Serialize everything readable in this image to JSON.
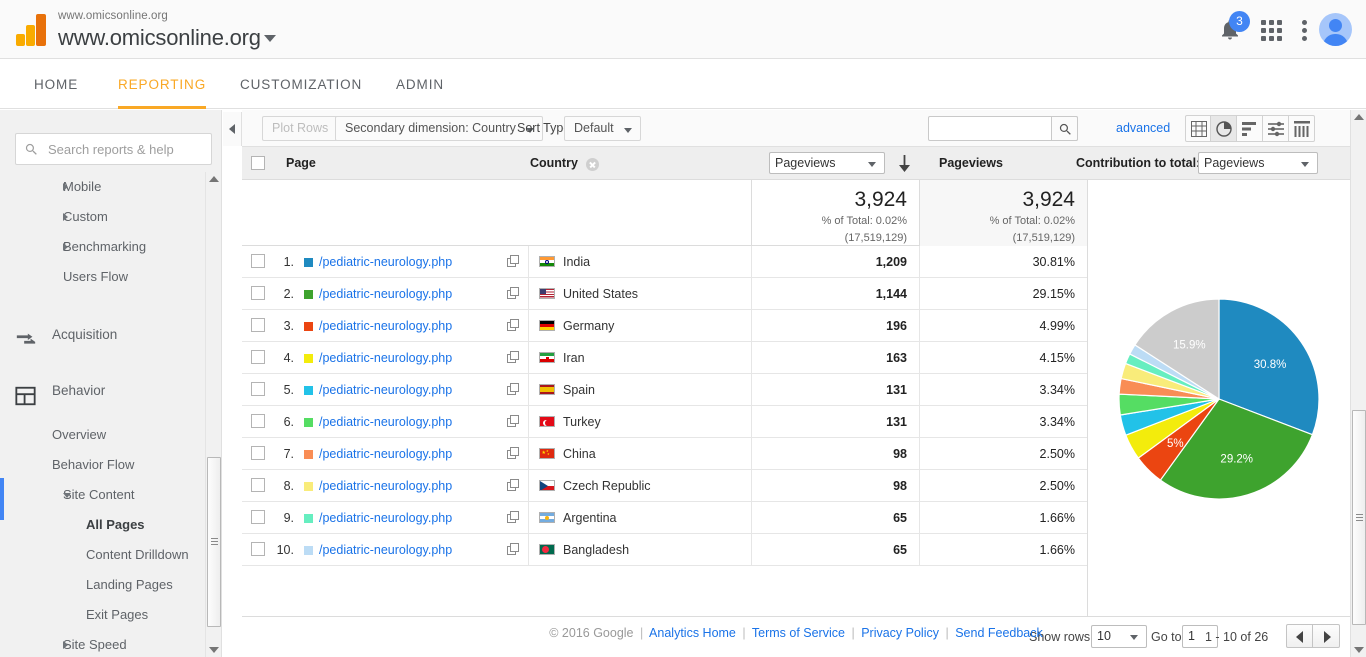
{
  "header": {
    "property_sub": "www.omicsonline.org",
    "property_title": "www.omicsonline.org",
    "notifications_count": "3"
  },
  "nav_tabs": [
    {
      "label": "HOME",
      "active": false
    },
    {
      "label": "REPORTING",
      "active": true
    },
    {
      "label": "CUSTOMIZATION",
      "active": false
    },
    {
      "label": "ADMIN",
      "active": false
    }
  ],
  "sidebar": {
    "search_placeholder": "Search reports & help",
    "items": [
      {
        "label": "Mobile",
        "level": 2,
        "arrow": "right"
      },
      {
        "label": "Custom",
        "level": 2,
        "arrow": "right"
      },
      {
        "label": "Benchmarking",
        "level": 2,
        "arrow": "right"
      },
      {
        "label": "Users Flow",
        "level": 2,
        "arrow": "none"
      },
      {
        "label": "Acquisition",
        "level": 0,
        "arrow": "none",
        "icon": "acquisition-icon"
      },
      {
        "label": "Behavior",
        "level": 0,
        "arrow": "none",
        "icon": "behavior-icon",
        "selected_section": true
      },
      {
        "label": "Overview",
        "level": 1,
        "arrow": "none"
      },
      {
        "label": "Behavior Flow",
        "level": 1,
        "arrow": "none"
      },
      {
        "label": "Site Content",
        "level": 2,
        "arrow": "down"
      },
      {
        "label": "All Pages",
        "level": 3,
        "arrow": "none",
        "selected": true
      },
      {
        "label": "Content Drilldown",
        "level": 3,
        "arrow": "none"
      },
      {
        "label": "Landing Pages",
        "level": 3,
        "arrow": "none"
      },
      {
        "label": "Exit Pages",
        "level": 3,
        "arrow": "none"
      },
      {
        "label": "Site Speed",
        "level": 2,
        "arrow": "right"
      }
    ]
  },
  "toolbar": {
    "plot_rows_label": "Plot Rows",
    "secondary_dimension_label": "Secondary dimension: Country",
    "sort_type_label": "Sort Type:",
    "sort_type_value": "Default",
    "search_value": "",
    "advanced_label": "advanced",
    "view_icons": [
      {
        "name": "table-view-icon",
        "active": false
      },
      {
        "name": "pie-chart-view-icon",
        "active": true
      },
      {
        "name": "bar-chart-view-icon",
        "active": false
      },
      {
        "name": "comparison-view-icon",
        "active": false
      },
      {
        "name": "pivot-view-icon",
        "active": false
      }
    ]
  },
  "table": {
    "headers": {
      "page": "Page",
      "country": "Country",
      "metric_select": "Pageviews",
      "pageviews": "Pageviews",
      "contribution_label": "Contribution to total:",
      "contribution_select": "Pageviews"
    },
    "totals": {
      "pageviews_value": "3,924",
      "pageviews_pct": "% of Total: 0.02%",
      "pageviews_abs": "(17,519,129)",
      "contrib_value": "3,924",
      "contrib_pct": "% of Total: 0.02%",
      "contrib_abs": "(17,519,129)"
    },
    "rows": [
      {
        "index": "1.",
        "page": "/pediatric-neurology.php",
        "country": "India",
        "pageviews": "1,209",
        "contribution": "30.81%",
        "color": "#1f8ac0",
        "flag": "in"
      },
      {
        "index": "2.",
        "page": "/pediatric-neurology.php",
        "country": "United States",
        "pageviews": "1,144",
        "contribution": "29.15%",
        "color": "#3ea32e",
        "flag": "us"
      },
      {
        "index": "3.",
        "page": "/pediatric-neurology.php",
        "country": "Germany",
        "pageviews": "196",
        "contribution": "4.99%",
        "color": "#eb4511",
        "flag": "de"
      },
      {
        "index": "4.",
        "page": "/pediatric-neurology.php",
        "country": "Iran",
        "pageviews": "163",
        "contribution": "4.15%",
        "color": "#f3ec0c",
        "flag": "ir"
      },
      {
        "index": "5.",
        "page": "/pediatric-neurology.php",
        "country": "Spain",
        "pageviews": "131",
        "contribution": "3.34%",
        "color": "#22c2e8",
        "flag": "es"
      },
      {
        "index": "6.",
        "page": "/pediatric-neurology.php",
        "country": "Turkey",
        "pageviews": "131",
        "contribution": "3.34%",
        "color": "#55dd63",
        "flag": "tr"
      },
      {
        "index": "7.",
        "page": "/pediatric-neurology.php",
        "country": "China",
        "pageviews": "98",
        "contribution": "2.50%",
        "color": "#f98d55",
        "flag": "cn"
      },
      {
        "index": "8.",
        "page": "/pediatric-neurology.php",
        "country": "Czech Republic",
        "pageviews": "98",
        "contribution": "2.50%",
        "color": "#f9ec7a",
        "flag": "cz"
      },
      {
        "index": "9.",
        "page": "/pediatric-neurology.php",
        "country": "Argentina",
        "pageviews": "65",
        "contribution": "1.66%",
        "color": "#66eec0",
        "flag": "ar"
      },
      {
        "index": "10.",
        "page": "/pediatric-neurology.php",
        "country": "Bangladesh",
        "pageviews": "65",
        "contribution": "1.66%",
        "color": "#bcdcf5",
        "flag": "bd"
      }
    ]
  },
  "chart_data": {
    "type": "pie",
    "title": "",
    "metric": "Pageviews",
    "legend": "none",
    "labels_shown": [
      "30.8%",
      "29.2%",
      "5%",
      "15.9%"
    ],
    "categories": [
      "India",
      "United States",
      "Germany",
      "Iran",
      "Spain",
      "Turkey",
      "China",
      "Czech Republic",
      "Argentina",
      "Bangladesh",
      "Other"
    ],
    "values": [
      30.81,
      29.15,
      4.99,
      4.15,
      3.34,
      3.34,
      2.5,
      2.5,
      1.66,
      1.66,
      15.9
    ],
    "raw_values": [
      1209,
      1144,
      196,
      163,
      131,
      131,
      98,
      98,
      65,
      65,
      624
    ],
    "colors": [
      "#1f8ac0",
      "#3ea32e",
      "#eb4511",
      "#f3ec0c",
      "#22c2e8",
      "#55dd63",
      "#f98d55",
      "#f9ec7a",
      "#66eec0",
      "#bcdcf5",
      "#cccccc"
    ],
    "slice_labels": [
      "30.8%",
      "29.2%",
      "5%",
      "",
      "",
      "",
      "",
      "",
      "",
      "",
      "15.9%"
    ]
  },
  "pagination": {
    "show_rows_label": "Show rows:",
    "show_rows_value": "10",
    "go_to_label": "Go to:",
    "go_to_value": "1",
    "range_label": "1 - 10 of 26"
  },
  "footer": {
    "copyright": "© 2016 Google",
    "links": [
      "Analytics Home",
      "Terms of Service",
      "Privacy Policy",
      "Send Feedback"
    ]
  }
}
